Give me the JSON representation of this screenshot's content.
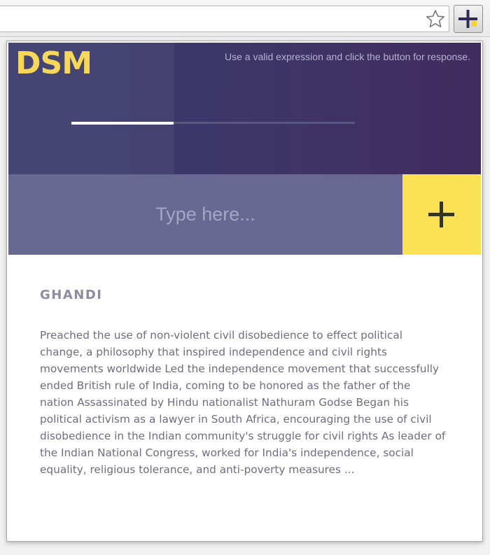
{
  "browser": {
    "bookmark_icon": "star-outline-icon",
    "extension_icon": "plus-icon"
  },
  "popup": {
    "logo": "DSM",
    "hint": "Use a valid expression and click the button for response.",
    "progress": 0.36,
    "search": {
      "placeholder": "Type here...",
      "value": ""
    },
    "submit_icon": "plus-icon",
    "result": {
      "title": "GHANDI",
      "body": "Preached the use of non-violent civil disobedience to effect political change, a philosophy that inspired independence and civil rights movements worldwide Led the independence movement that successfully ended British rule of India, coming to be honored as the father of the nation Assassinated by Hindu nationalist Nathuram Godse Began his political activism as a lawyer in South Africa, encouraging the use of civil disobedience in the Indian community's struggle for civil rights As leader of the Indian National Congress, worked for India's independence, social equality, religious tolerance, and anti-poverty measures ..."
    }
  },
  "colors": {
    "header": "#3d3566",
    "logo": "#f7d75a",
    "input_bg": "#686893",
    "accent": "#fde154",
    "text": "#6e6e80"
  }
}
